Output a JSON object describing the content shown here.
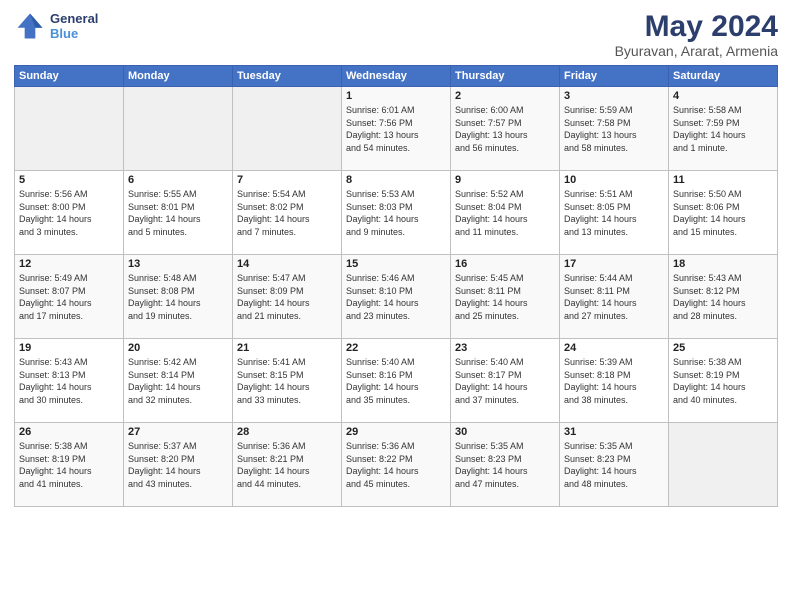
{
  "header": {
    "logo_line1": "General",
    "logo_line2": "Blue",
    "title": "May 2024",
    "subtitle": "Byuravan, Ararat, Armenia"
  },
  "days_of_week": [
    "Sunday",
    "Monday",
    "Tuesday",
    "Wednesday",
    "Thursday",
    "Friday",
    "Saturday"
  ],
  "weeks": [
    [
      {
        "day": "",
        "info": ""
      },
      {
        "day": "",
        "info": ""
      },
      {
        "day": "",
        "info": ""
      },
      {
        "day": "1",
        "info": "Sunrise: 6:01 AM\nSunset: 7:56 PM\nDaylight: 13 hours\nand 54 minutes."
      },
      {
        "day": "2",
        "info": "Sunrise: 6:00 AM\nSunset: 7:57 PM\nDaylight: 13 hours\nand 56 minutes."
      },
      {
        "day": "3",
        "info": "Sunrise: 5:59 AM\nSunset: 7:58 PM\nDaylight: 13 hours\nand 58 minutes."
      },
      {
        "day": "4",
        "info": "Sunrise: 5:58 AM\nSunset: 7:59 PM\nDaylight: 14 hours\nand 1 minute."
      }
    ],
    [
      {
        "day": "5",
        "info": "Sunrise: 5:56 AM\nSunset: 8:00 PM\nDaylight: 14 hours\nand 3 minutes."
      },
      {
        "day": "6",
        "info": "Sunrise: 5:55 AM\nSunset: 8:01 PM\nDaylight: 14 hours\nand 5 minutes."
      },
      {
        "day": "7",
        "info": "Sunrise: 5:54 AM\nSunset: 8:02 PM\nDaylight: 14 hours\nand 7 minutes."
      },
      {
        "day": "8",
        "info": "Sunrise: 5:53 AM\nSunset: 8:03 PM\nDaylight: 14 hours\nand 9 minutes."
      },
      {
        "day": "9",
        "info": "Sunrise: 5:52 AM\nSunset: 8:04 PM\nDaylight: 14 hours\nand 11 minutes."
      },
      {
        "day": "10",
        "info": "Sunrise: 5:51 AM\nSunset: 8:05 PM\nDaylight: 14 hours\nand 13 minutes."
      },
      {
        "day": "11",
        "info": "Sunrise: 5:50 AM\nSunset: 8:06 PM\nDaylight: 14 hours\nand 15 minutes."
      }
    ],
    [
      {
        "day": "12",
        "info": "Sunrise: 5:49 AM\nSunset: 8:07 PM\nDaylight: 14 hours\nand 17 minutes."
      },
      {
        "day": "13",
        "info": "Sunrise: 5:48 AM\nSunset: 8:08 PM\nDaylight: 14 hours\nand 19 minutes."
      },
      {
        "day": "14",
        "info": "Sunrise: 5:47 AM\nSunset: 8:09 PM\nDaylight: 14 hours\nand 21 minutes."
      },
      {
        "day": "15",
        "info": "Sunrise: 5:46 AM\nSunset: 8:10 PM\nDaylight: 14 hours\nand 23 minutes."
      },
      {
        "day": "16",
        "info": "Sunrise: 5:45 AM\nSunset: 8:11 PM\nDaylight: 14 hours\nand 25 minutes."
      },
      {
        "day": "17",
        "info": "Sunrise: 5:44 AM\nSunset: 8:11 PM\nDaylight: 14 hours\nand 27 minutes."
      },
      {
        "day": "18",
        "info": "Sunrise: 5:43 AM\nSunset: 8:12 PM\nDaylight: 14 hours\nand 28 minutes."
      }
    ],
    [
      {
        "day": "19",
        "info": "Sunrise: 5:43 AM\nSunset: 8:13 PM\nDaylight: 14 hours\nand 30 minutes."
      },
      {
        "day": "20",
        "info": "Sunrise: 5:42 AM\nSunset: 8:14 PM\nDaylight: 14 hours\nand 32 minutes."
      },
      {
        "day": "21",
        "info": "Sunrise: 5:41 AM\nSunset: 8:15 PM\nDaylight: 14 hours\nand 33 minutes."
      },
      {
        "day": "22",
        "info": "Sunrise: 5:40 AM\nSunset: 8:16 PM\nDaylight: 14 hours\nand 35 minutes."
      },
      {
        "day": "23",
        "info": "Sunrise: 5:40 AM\nSunset: 8:17 PM\nDaylight: 14 hours\nand 37 minutes."
      },
      {
        "day": "24",
        "info": "Sunrise: 5:39 AM\nSunset: 8:18 PM\nDaylight: 14 hours\nand 38 minutes."
      },
      {
        "day": "25",
        "info": "Sunrise: 5:38 AM\nSunset: 8:19 PM\nDaylight: 14 hours\nand 40 minutes."
      }
    ],
    [
      {
        "day": "26",
        "info": "Sunrise: 5:38 AM\nSunset: 8:19 PM\nDaylight: 14 hours\nand 41 minutes."
      },
      {
        "day": "27",
        "info": "Sunrise: 5:37 AM\nSunset: 8:20 PM\nDaylight: 14 hours\nand 43 minutes."
      },
      {
        "day": "28",
        "info": "Sunrise: 5:36 AM\nSunset: 8:21 PM\nDaylight: 14 hours\nand 44 minutes."
      },
      {
        "day": "29",
        "info": "Sunrise: 5:36 AM\nSunset: 8:22 PM\nDaylight: 14 hours\nand 45 minutes."
      },
      {
        "day": "30",
        "info": "Sunrise: 5:35 AM\nSunset: 8:23 PM\nDaylight: 14 hours\nand 47 minutes."
      },
      {
        "day": "31",
        "info": "Sunrise: 5:35 AM\nSunset: 8:23 PM\nDaylight: 14 hours\nand 48 minutes."
      },
      {
        "day": "",
        "info": ""
      }
    ]
  ]
}
